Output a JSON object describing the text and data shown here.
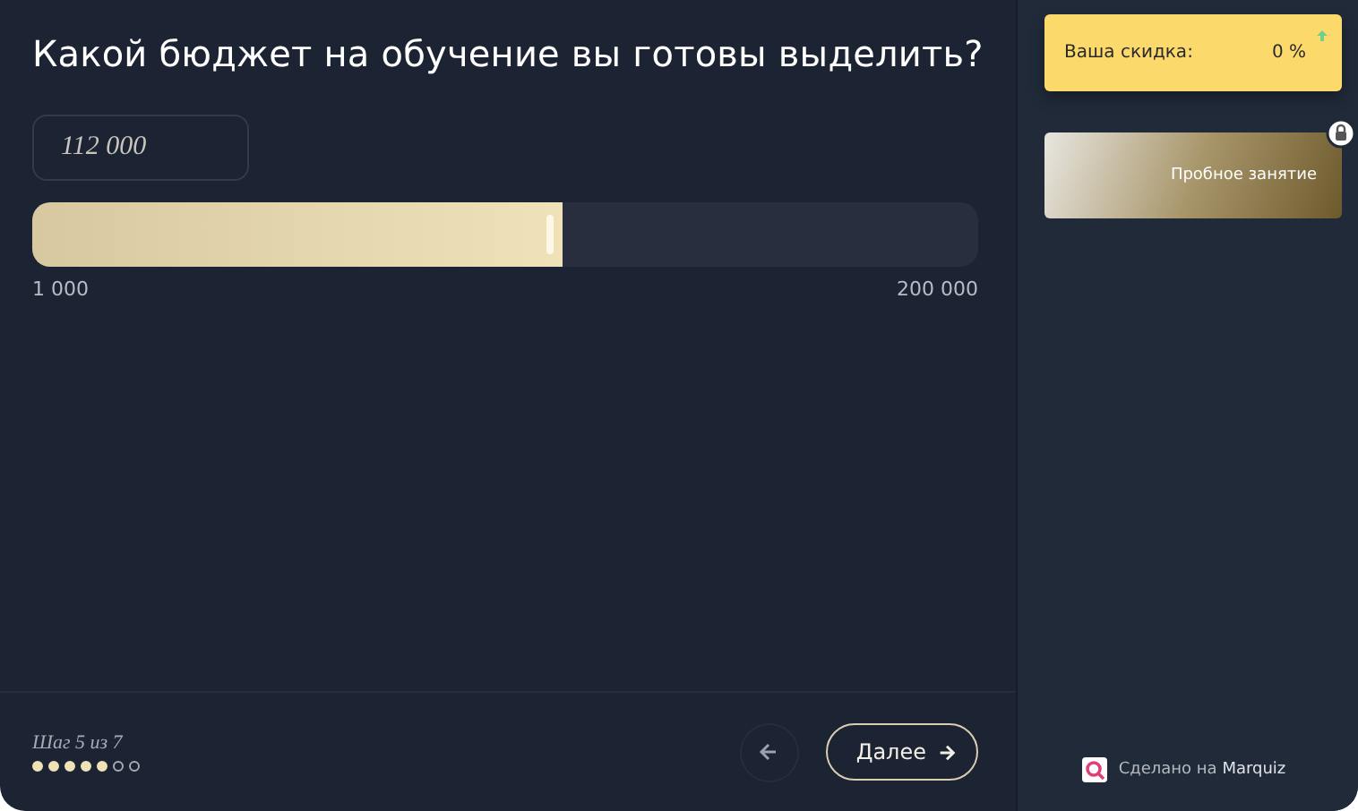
{
  "question": {
    "title": "Какой бюджет на обучение вы готовы выделить?"
  },
  "budget": {
    "value": "112 000",
    "level": 0.56,
    "min": "1 000",
    "max": "200 000"
  },
  "footer": {
    "step_label": "Шаг 5 из 7",
    "steps": [
      {
        "done": true
      },
      {
        "done": true
      },
      {
        "done": true
      },
      {
        "done": true
      },
      {
        "done": true
      },
      {
        "done": false
      },
      {
        "done": false
      }
    ],
    "next_label": "Далее"
  },
  "sidebar": {
    "discount_label": "Ваша скидка:",
    "discount_value": "0 %",
    "bonus": {
      "label": "Пробное занятие",
      "locked": true
    },
    "made_with": "Сделано на",
    "brand": "Marquiz"
  }
}
